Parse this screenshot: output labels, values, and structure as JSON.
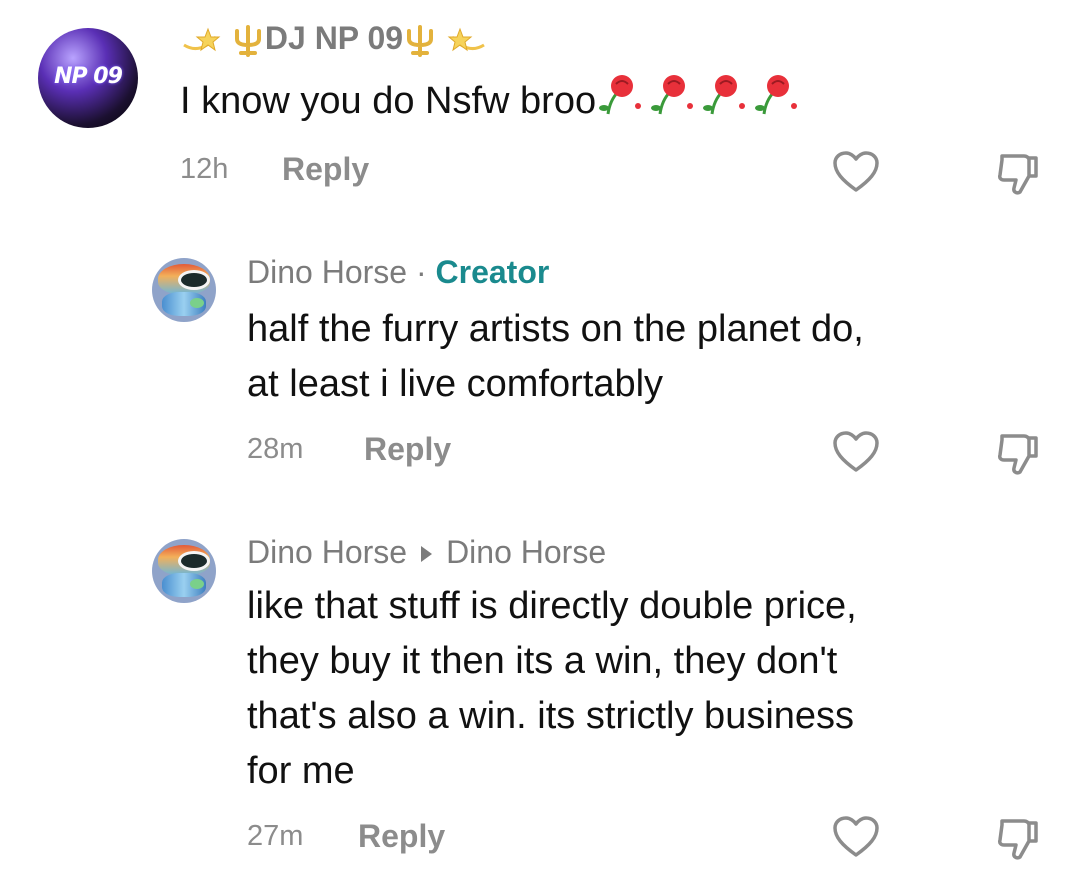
{
  "comments": [
    {
      "username": "DJ NP 09",
      "avatar_text": "NP 09",
      "body": "I know you do Nsfw broo",
      "body_emoji": "rose-emojis",
      "time": "12h",
      "reply_label": "Reply"
    },
    {
      "username": "Dino Horse",
      "separator": "·",
      "creator_badge": "Creator",
      "body_lines": [
        "half the furry artists on the planet do,",
        "at least i live comfortably"
      ],
      "time": "28m",
      "reply_label": "Reply"
    },
    {
      "username": "Dino Horse",
      "reply_to": "Dino Horse",
      "body_lines": [
        "like that stuff is directly double price,",
        "they buy it then its a win, they don't",
        "that's also a win. its strictly business",
        "for me"
      ],
      "time": "27m",
      "reply_label": "Reply"
    }
  ],
  "colors": {
    "creator": "#1a8a8e",
    "meta": "#8c8c8c",
    "username": "#7b7b7b",
    "rose": "#e8303a"
  },
  "icons": {
    "like": "heart-outline-icon",
    "dislike": "thumb-down-outline-icon",
    "trident": "trident-icon",
    "star": "dizzy-star-icon"
  }
}
